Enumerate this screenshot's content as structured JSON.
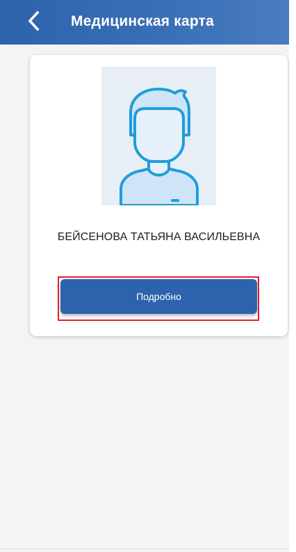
{
  "header": {
    "title": "Медицинская карта",
    "back_icon": "chevron-left-icon"
  },
  "patient_card": {
    "name": "БЕЙСЕНОВА ТАТЬЯНА ВАСИЛЬЕВНА",
    "avatar_icon": "user-avatar-icon",
    "details_button_label": "Подробно"
  },
  "colors": {
    "primary": "#2d63ad",
    "highlight": "#e51e2b",
    "background": "#f4f4f5",
    "avatar_stroke": "#1e9ed8",
    "avatar_fill": "#cfe4f6"
  }
}
